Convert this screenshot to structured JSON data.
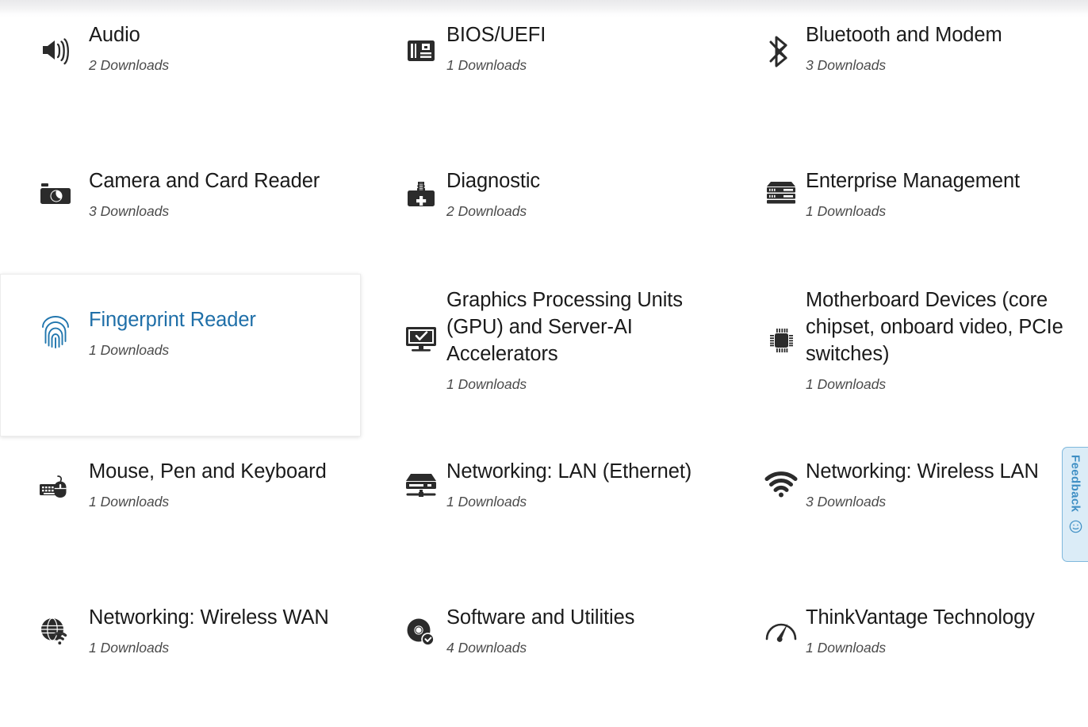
{
  "page": {
    "accent_color": "#2176ae",
    "text_color": "#1a1a1a",
    "count_color": "#4b4b4b",
    "icon_color": "#2b2b2b"
  },
  "categories": [
    {
      "title": "Audio",
      "count": "2 Downloads",
      "icon": "speaker-icon",
      "hovered": false
    },
    {
      "title": "BIOS/UEFI",
      "count": "1 Downloads",
      "icon": "memory-module-icon",
      "hovered": false
    },
    {
      "title": "Bluetooth and Modem",
      "count": "3 Downloads",
      "icon": "bluetooth-icon",
      "hovered": false
    },
    {
      "title": "Camera and Card Reader",
      "count": "3 Downloads",
      "icon": "camera-icon",
      "hovered": false
    },
    {
      "title": "Diagnostic",
      "count": "2 Downloads",
      "icon": "toolbox-icon",
      "hovered": false
    },
    {
      "title": "Enterprise Management",
      "count": "1 Downloads",
      "icon": "server-rack-icon",
      "hovered": false
    },
    {
      "title": "Fingerprint Reader",
      "count": "1 Downloads",
      "icon": "fingerprint-icon",
      "hovered": true
    },
    {
      "title": "Graphics Processing Units (GPU) and Server-AI Accelerators",
      "count": "1 Downloads",
      "icon": "monitor-check-icon",
      "hovered": false
    },
    {
      "title": "Motherboard Devices (core chipset, onboard video, PCIe switches)",
      "count": "1 Downloads",
      "icon": "cpu-chip-icon",
      "hovered": false
    },
    {
      "title": "Mouse, Pen and Keyboard",
      "count": "1 Downloads",
      "icon": "keyboard-mouse-icon",
      "hovered": false
    },
    {
      "title": "Networking: LAN (Ethernet)",
      "count": "1 Downloads",
      "icon": "network-switch-icon",
      "hovered": false
    },
    {
      "title": "Networking: Wireless LAN",
      "count": "3 Downloads",
      "icon": "wifi-icon",
      "hovered": false
    },
    {
      "title": "Networking: Wireless WAN",
      "count": "1 Downloads",
      "icon": "globe-wifi-icon",
      "hovered": false
    },
    {
      "title": "Software and Utilities",
      "count": "4 Downloads",
      "icon": "disc-download-icon",
      "hovered": false
    },
    {
      "title": "ThinkVantage Technology",
      "count": "1 Downloads",
      "icon": "gauge-icon",
      "hovered": false
    }
  ],
  "feedback": {
    "label": "Feedback",
    "icon": "smiley-icon",
    "color": "#3f8fc4",
    "background": "#dbecf7"
  }
}
